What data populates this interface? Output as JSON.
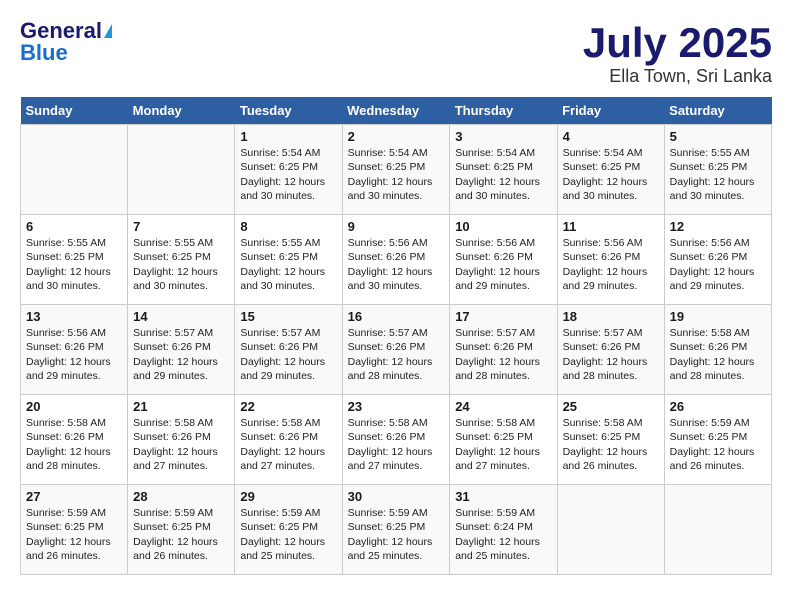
{
  "logo": {
    "general": "General",
    "blue": "Blue"
  },
  "title": {
    "month_year": "July 2025",
    "location": "Ella Town, Sri Lanka"
  },
  "headers": [
    "Sunday",
    "Monday",
    "Tuesday",
    "Wednesday",
    "Thursday",
    "Friday",
    "Saturday"
  ],
  "weeks": [
    [
      {
        "day": "",
        "info": ""
      },
      {
        "day": "",
        "info": ""
      },
      {
        "day": "1",
        "info": "Sunrise: 5:54 AM\nSunset: 6:25 PM\nDaylight: 12 hours and 30 minutes."
      },
      {
        "day": "2",
        "info": "Sunrise: 5:54 AM\nSunset: 6:25 PM\nDaylight: 12 hours and 30 minutes."
      },
      {
        "day": "3",
        "info": "Sunrise: 5:54 AM\nSunset: 6:25 PM\nDaylight: 12 hours and 30 minutes."
      },
      {
        "day": "4",
        "info": "Sunrise: 5:54 AM\nSunset: 6:25 PM\nDaylight: 12 hours and 30 minutes."
      },
      {
        "day": "5",
        "info": "Sunrise: 5:55 AM\nSunset: 6:25 PM\nDaylight: 12 hours and 30 minutes."
      }
    ],
    [
      {
        "day": "6",
        "info": "Sunrise: 5:55 AM\nSunset: 6:25 PM\nDaylight: 12 hours and 30 minutes."
      },
      {
        "day": "7",
        "info": "Sunrise: 5:55 AM\nSunset: 6:25 PM\nDaylight: 12 hours and 30 minutes."
      },
      {
        "day": "8",
        "info": "Sunrise: 5:55 AM\nSunset: 6:25 PM\nDaylight: 12 hours and 30 minutes."
      },
      {
        "day": "9",
        "info": "Sunrise: 5:56 AM\nSunset: 6:26 PM\nDaylight: 12 hours and 30 minutes."
      },
      {
        "day": "10",
        "info": "Sunrise: 5:56 AM\nSunset: 6:26 PM\nDaylight: 12 hours and 29 minutes."
      },
      {
        "day": "11",
        "info": "Sunrise: 5:56 AM\nSunset: 6:26 PM\nDaylight: 12 hours and 29 minutes."
      },
      {
        "day": "12",
        "info": "Sunrise: 5:56 AM\nSunset: 6:26 PM\nDaylight: 12 hours and 29 minutes."
      }
    ],
    [
      {
        "day": "13",
        "info": "Sunrise: 5:56 AM\nSunset: 6:26 PM\nDaylight: 12 hours and 29 minutes."
      },
      {
        "day": "14",
        "info": "Sunrise: 5:57 AM\nSunset: 6:26 PM\nDaylight: 12 hours and 29 minutes."
      },
      {
        "day": "15",
        "info": "Sunrise: 5:57 AM\nSunset: 6:26 PM\nDaylight: 12 hours and 29 minutes."
      },
      {
        "day": "16",
        "info": "Sunrise: 5:57 AM\nSunset: 6:26 PM\nDaylight: 12 hours and 28 minutes."
      },
      {
        "day": "17",
        "info": "Sunrise: 5:57 AM\nSunset: 6:26 PM\nDaylight: 12 hours and 28 minutes."
      },
      {
        "day": "18",
        "info": "Sunrise: 5:57 AM\nSunset: 6:26 PM\nDaylight: 12 hours and 28 minutes."
      },
      {
        "day": "19",
        "info": "Sunrise: 5:58 AM\nSunset: 6:26 PM\nDaylight: 12 hours and 28 minutes."
      }
    ],
    [
      {
        "day": "20",
        "info": "Sunrise: 5:58 AM\nSunset: 6:26 PM\nDaylight: 12 hours and 28 minutes."
      },
      {
        "day": "21",
        "info": "Sunrise: 5:58 AM\nSunset: 6:26 PM\nDaylight: 12 hours and 27 minutes."
      },
      {
        "day": "22",
        "info": "Sunrise: 5:58 AM\nSunset: 6:26 PM\nDaylight: 12 hours and 27 minutes."
      },
      {
        "day": "23",
        "info": "Sunrise: 5:58 AM\nSunset: 6:26 PM\nDaylight: 12 hours and 27 minutes."
      },
      {
        "day": "24",
        "info": "Sunrise: 5:58 AM\nSunset: 6:25 PM\nDaylight: 12 hours and 27 minutes."
      },
      {
        "day": "25",
        "info": "Sunrise: 5:58 AM\nSunset: 6:25 PM\nDaylight: 12 hours and 26 minutes."
      },
      {
        "day": "26",
        "info": "Sunrise: 5:59 AM\nSunset: 6:25 PM\nDaylight: 12 hours and 26 minutes."
      }
    ],
    [
      {
        "day": "27",
        "info": "Sunrise: 5:59 AM\nSunset: 6:25 PM\nDaylight: 12 hours and 26 minutes."
      },
      {
        "day": "28",
        "info": "Sunrise: 5:59 AM\nSunset: 6:25 PM\nDaylight: 12 hours and 26 minutes."
      },
      {
        "day": "29",
        "info": "Sunrise: 5:59 AM\nSunset: 6:25 PM\nDaylight: 12 hours and 25 minutes."
      },
      {
        "day": "30",
        "info": "Sunrise: 5:59 AM\nSunset: 6:25 PM\nDaylight: 12 hours and 25 minutes."
      },
      {
        "day": "31",
        "info": "Sunrise: 5:59 AM\nSunset: 6:24 PM\nDaylight: 12 hours and 25 minutes."
      },
      {
        "day": "",
        "info": ""
      },
      {
        "day": "",
        "info": ""
      }
    ]
  ]
}
